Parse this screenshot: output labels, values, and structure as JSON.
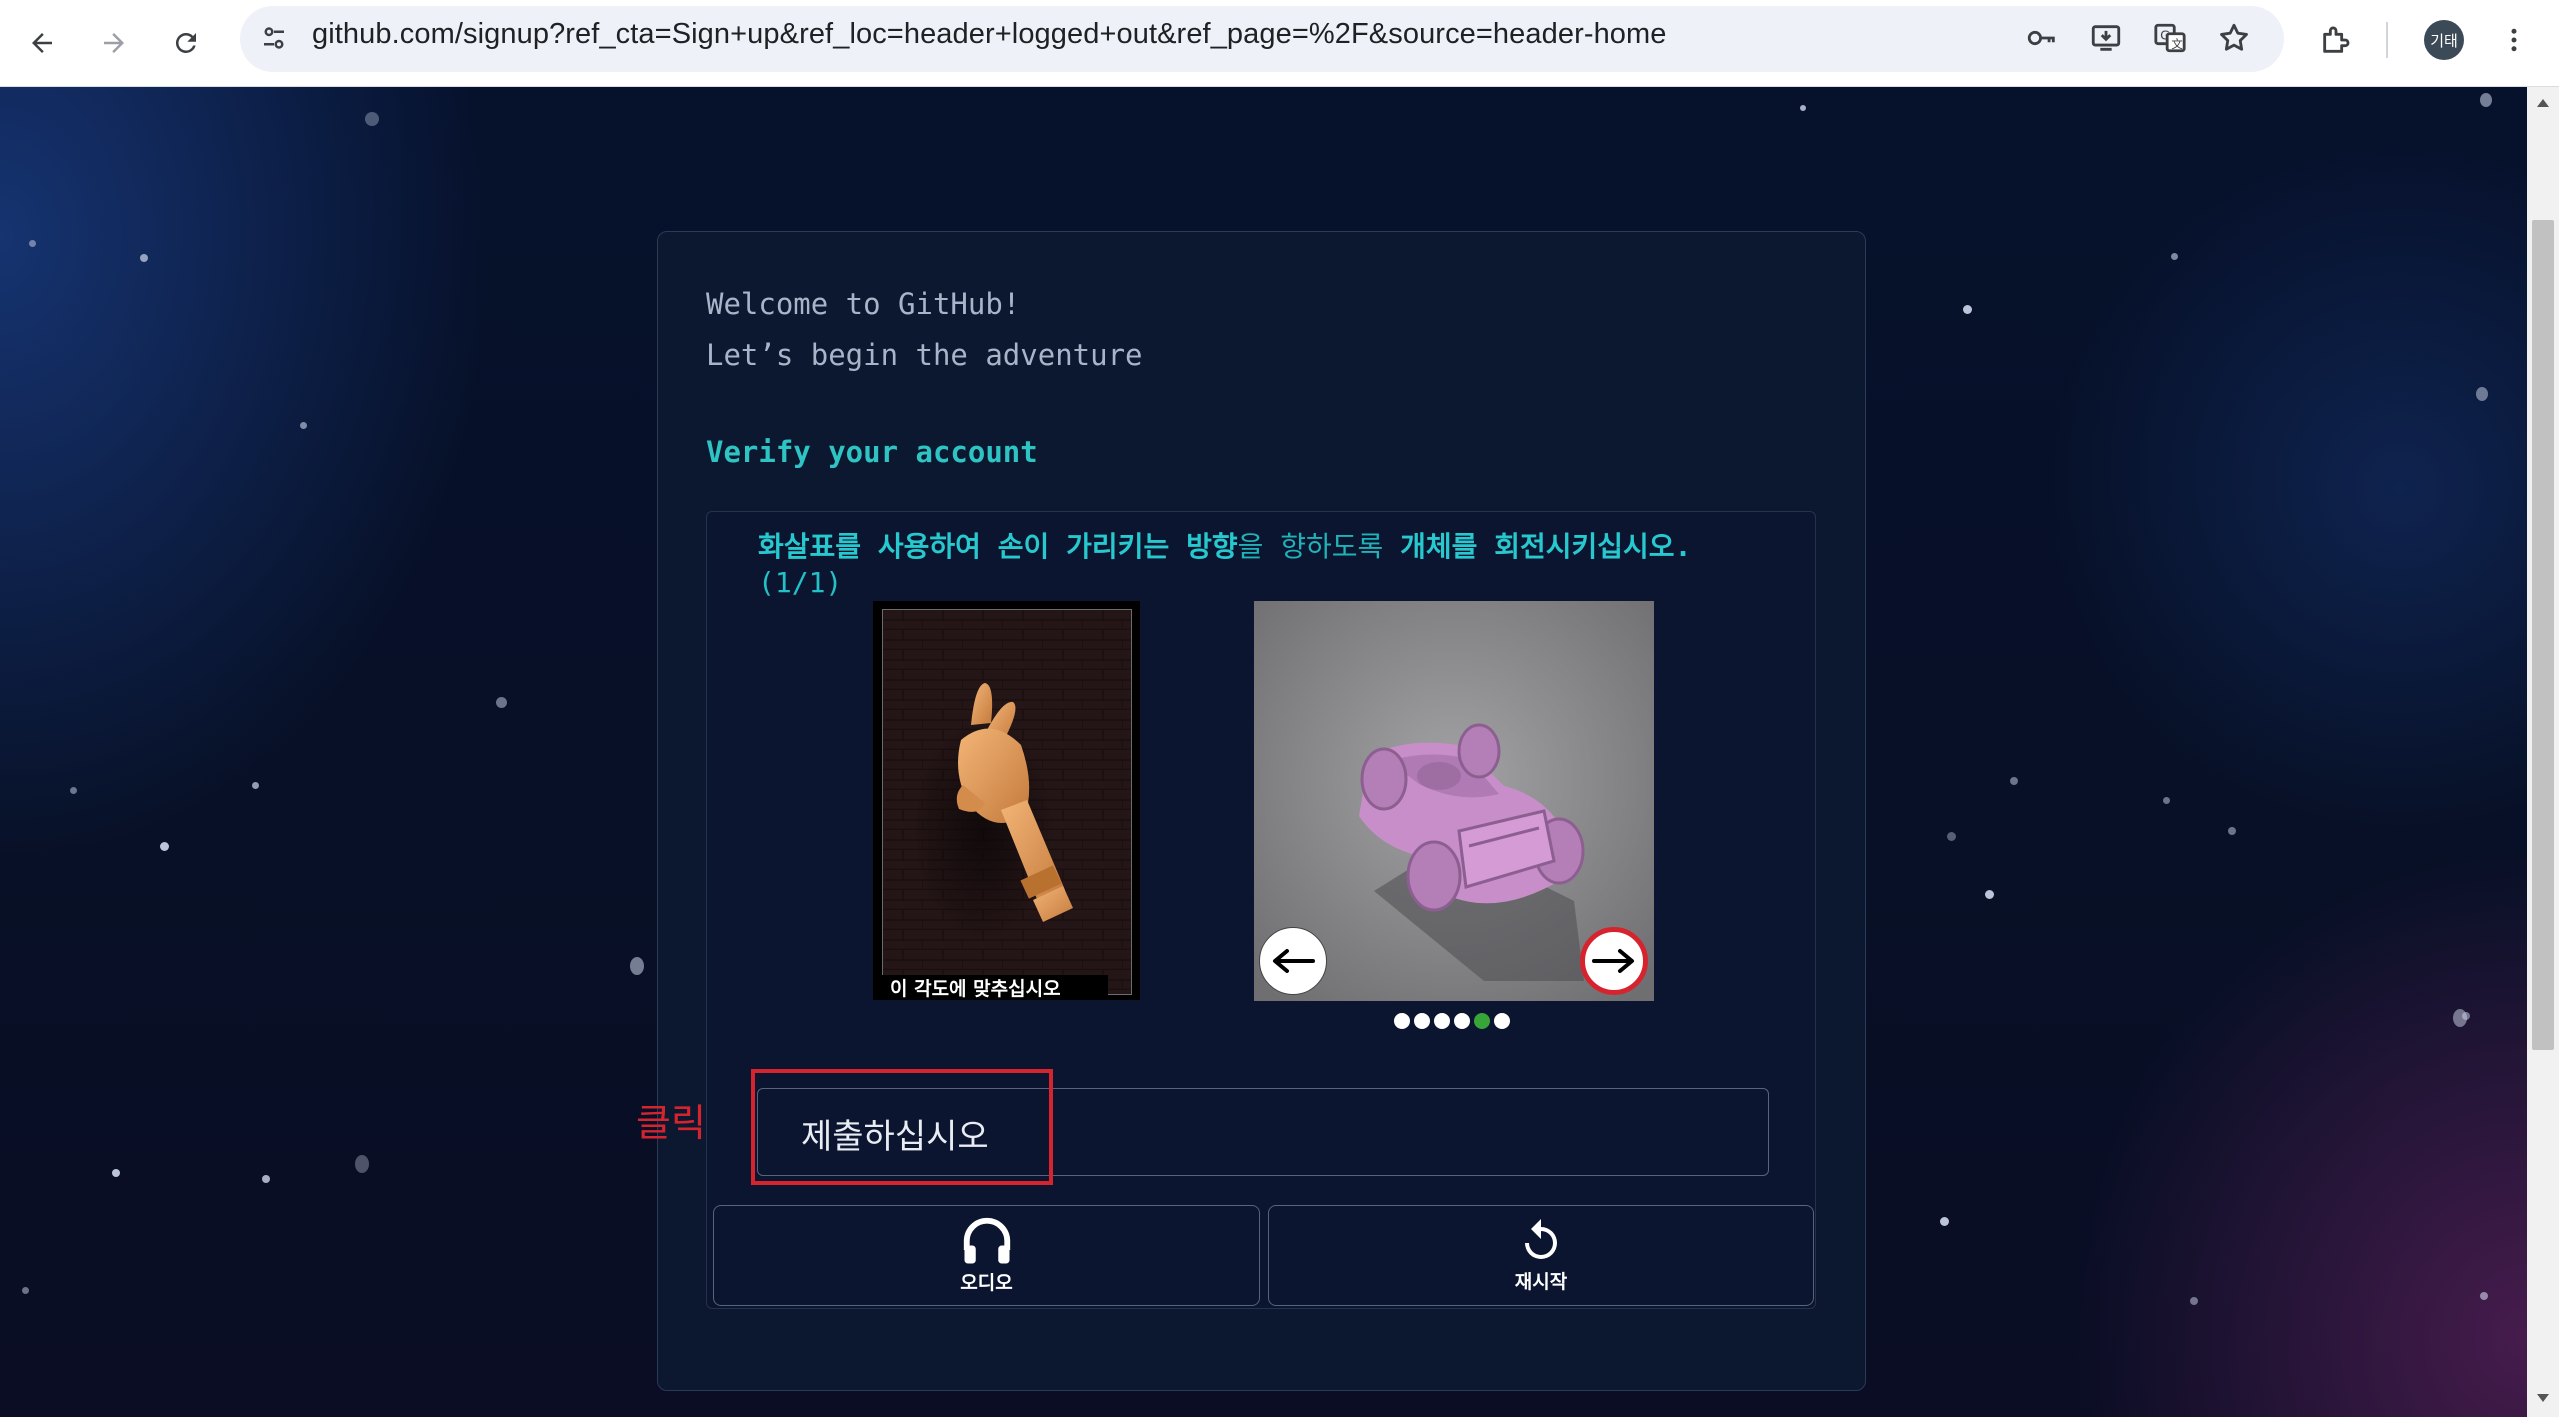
{
  "browser": {
    "url": "github.com/signup?ref_cta=Sign+up&ref_loc=header+logged+out&ref_page=%2F&source=header-home",
    "profile_label": "기태"
  },
  "card": {
    "welcome": "Welcome to GitHub!",
    "adventure": "Let’s begin the adventure",
    "verify_heading": "Verify your account"
  },
  "captcha": {
    "instruction_part1": "화살표를 사용하여 손이 가리키는 방향",
    "instruction_part2": "을 향하도록 ",
    "instruction_part3": "개체를 회전시키십시오.",
    "progress": "(1/1)",
    "reference_caption": "이 각도에 맞추십시오",
    "dots_total": 6,
    "dots_active_index": 4
  },
  "annotation": {
    "label": "클릭",
    "color": "#d6242f"
  },
  "actions": {
    "submit_label": "제출하십시오",
    "audio_label": "오디오",
    "restart_label": "재시작"
  },
  "colors": {
    "accent": "#2ec4c4",
    "card_bg": "#0c1730",
    "active_dot": "#37a537"
  }
}
